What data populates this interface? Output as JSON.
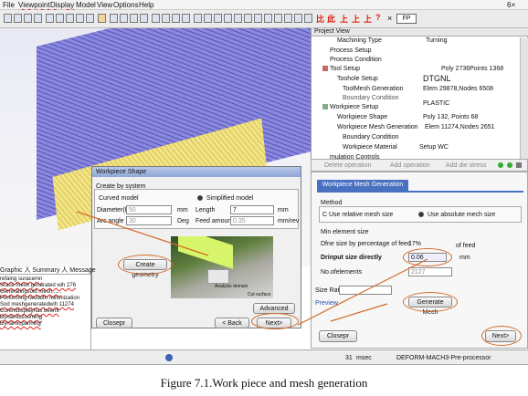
{
  "menu": {
    "items": [
      "File",
      "Viewpoint",
      "Display",
      "Model",
      "View",
      "Options",
      "Help"
    ],
    "right_label": "6×"
  },
  "toolbar": {
    "zoom_label": "FP",
    "close_glyph": "×",
    "red_icons": [
      "比",
      "此",
      "上",
      "上",
      "上",
      "?"
    ]
  },
  "project_view": {
    "title": "Project View",
    "rows": [
      {
        "label": "Machining Type",
        "value": "Turning"
      },
      {
        "label": "Process Setup",
        "value": ""
      },
      {
        "label": "Process Condition",
        "value": ""
      },
      {
        "label": "Tool Setup",
        "value": "Poly 2736Points 1368"
      },
      {
        "label": "Toohole Setup",
        "value": "DTGNL"
      },
      {
        "label": "ToolMesh Generation",
        "value": "Elem 29878,Nodes 6508"
      },
      {
        "label": "Boundary Condition",
        "value": ""
      },
      {
        "label": "Workpiece Setup",
        "value": "PLASTIC"
      },
      {
        "label": "Workpiece Shape",
        "value": "Poly 132, Points 68"
      },
      {
        "label": "Workpiece Mesh Generation",
        "value": "Elem 11274,Nodes 2651"
      },
      {
        "label": "Boundary Condition",
        "value": ""
      },
      {
        "label": "Workpiece Material",
        "value": "Setup WC"
      },
      {
        "label": "mulation Controls",
        "value": ""
      }
    ]
  },
  "operations_bar": {
    "delete": "Delete operation",
    "add": "Add operation",
    "add_die": "Add die stress"
  },
  "mesh_panel": {
    "tab_label": "Workpiece Mesh Generation",
    "method_label": "Method",
    "relative_label": "C Use relative mesh size",
    "absolute_label": "Use absolute mech size",
    "min_element_label": "Min element size",
    "percentage_label": "Dfne size by percentage of feed",
    "percentage_value": "17%",
    "percentage_suffix": "of feed",
    "direct_label": "Drinput size directly",
    "direct_value": "0.06",
    "direct_unit": "mm",
    "elements_label": "No.ofelements",
    "elements_value": "2127",
    "size_ratio_label": "Size Ratio 7",
    "preview_label": "Preview",
    "generate_label": "Generate Mech",
    "close_label": "Closepr",
    "next_label": "Next>"
  },
  "dialog": {
    "title": "Workpiece Shape",
    "create_label": "Create by system",
    "curved_label": "Curved model",
    "simplified_label": "Simplified model",
    "diameter_label": "Diameter(D)",
    "diameter_value": "50",
    "diameter_unit": "mm",
    "arc_label": "Arc angle",
    "arc_value": "30",
    "arc_unit": "Deg",
    "length_label": "Length",
    "length_value": "7",
    "length_unit": "mm",
    "feed_label": "Feed amount",
    "feed_value": "0.35",
    "feed_unit": "mm/rev",
    "create_geometry": "Create geometry",
    "analysis_label": "Analysis domain",
    "cut_label": "Cut surface",
    "advanced_label": "Advanced",
    "back_label": "< Back",
    "next_label": "Next>",
    "close_label": "Closepr"
  },
  "messages": {
    "header": "Graphic 人 Summary 人 Message",
    "lines": [
      "refaing suracemn",
      "Srace mesh generated wih 276",
      "Generatingsoid mesh......",
      "Performing twodoth minimization",
      "Sod meshgeneratedwih 11274",
      "Curentdisplayhas beenft",
      "Dynamiczooming",
      "Dynamicpanning"
    ]
  },
  "status": {
    "count": "31",
    "unit": "msec",
    "app_name": "DEFORM-MACH3-Pre-processor"
  },
  "caption": "Figure 7.1.Work piece and mesh generation",
  "colors": {
    "tab_blue": "#4a70c2",
    "highlight": "#d2692a",
    "mesh_blue": "#6a68c8",
    "mesh_yellow": "#e8d76a"
  }
}
